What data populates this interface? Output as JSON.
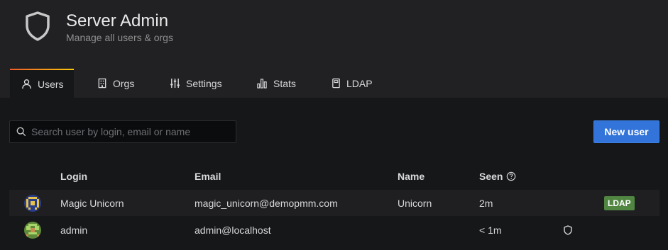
{
  "header": {
    "icon": "shield-icon",
    "title": "Server Admin",
    "subtitle": "Manage all users & orgs"
  },
  "tabs": [
    {
      "label": "Users",
      "icon": "user-icon",
      "active": true
    },
    {
      "label": "Orgs",
      "icon": "building-icon",
      "active": false
    },
    {
      "label": "Settings",
      "icon": "sliders-icon",
      "active": false
    },
    {
      "label": "Stats",
      "icon": "bar-chart-icon",
      "active": false
    },
    {
      "label": "LDAP",
      "icon": "book-icon",
      "active": false
    }
  ],
  "search": {
    "placeholder": "Search user by login, email or name",
    "value": ""
  },
  "new_user_label": "New user",
  "table": {
    "columns": [
      "Login",
      "Email",
      "Name",
      "Seen"
    ],
    "rows": [
      {
        "login": "Magic Unicorn",
        "email": "magic_unicorn@demopmm.com",
        "name": "Unicorn",
        "seen": "2m",
        "badge": "LDAP"
      },
      {
        "login": "admin",
        "email": "admin@localhost",
        "name": "",
        "seen": "< 1m",
        "admin_icon": "shield-icon"
      }
    ]
  },
  "colors": {
    "accent": "#3274d9",
    "badge_ldap": "#508642",
    "tab_gradient_start": "#f05a28",
    "tab_gradient_end": "#fbca0a"
  }
}
